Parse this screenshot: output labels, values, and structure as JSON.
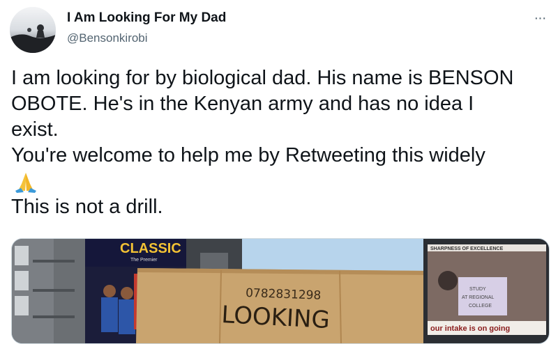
{
  "author": {
    "display_name": "I Am Looking For My Dad",
    "handle": "@Bensonkirobi",
    "avatar_icon": "profile-avatar"
  },
  "more_menu": {
    "icon": "more-options-icon",
    "glyph": "···"
  },
  "tweet": {
    "lines": [
      "I am looking for by biological dad. His name is BENSON",
      "OBOTE. He's in the Kenyan army and has no idea I",
      "exist.",
      "You're welcome to help me by Retweeting this widely",
      "This is not a drill."
    ],
    "emoji_icon": "folded-hands-emoji"
  },
  "media": {
    "billboard_text": "CLASSIC",
    "billboard_sub": "The Premier",
    "cardboard_phone": "0782831298",
    "cardboard_text": "LOOKING",
    "banner_top": "SHARPNESS OF EXCELLENCE",
    "banner_sign": [
      "STUDY",
      "AT REGIONAL",
      "COLLEGE"
    ],
    "banner_bottom": "our intake is on going"
  },
  "colors": {
    "text_primary": "#0f1419",
    "text_secondary": "#536471",
    "emoji_yellow": "#f4c23a",
    "cardboard": "#c9a46f"
  }
}
